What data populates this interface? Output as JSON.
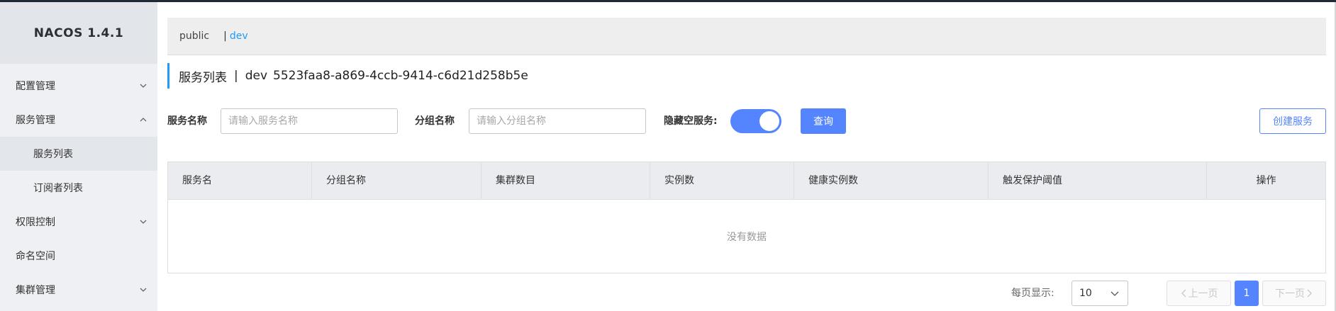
{
  "app": {
    "title": "NACOS 1.4.1"
  },
  "sidebar": {
    "items": [
      {
        "label": "配置管理",
        "icon": "chevron-down-icon"
      },
      {
        "label": "服务管理",
        "icon": "chevron-up-icon"
      },
      {
        "label": "服务列表",
        "selected": true
      },
      {
        "label": "订阅者列表"
      },
      {
        "label": "权限控制",
        "icon": "chevron-down-icon"
      },
      {
        "label": "命名空间"
      },
      {
        "label": "集群管理",
        "icon": "chevron-down-icon"
      }
    ]
  },
  "namespace_bar": {
    "public": "public",
    "separator": "|",
    "dev": "dev"
  },
  "page": {
    "title": "服务列表",
    "separator": "|",
    "namespace": "dev",
    "namespace_id": "5523faa8-a869-4ccb-9414-c6d21d258b5e"
  },
  "filters": {
    "service_name_label": "服务名称",
    "service_name_placeholder": "请输入服务名称",
    "group_name_label": "分组名称",
    "group_name_placeholder": "请输入分组名称",
    "hide_empty_label": "隐藏空服务:",
    "hide_empty_on": true,
    "query_button": "查询",
    "create_button": "创建服务"
  },
  "table": {
    "columns": [
      "服务名",
      "分组名称",
      "集群数目",
      "实例数",
      "健康实例数",
      "触发保护阈值",
      "操作"
    ],
    "rows": [],
    "empty_text": "没有数据"
  },
  "pagination": {
    "page_size_label": "每页显示:",
    "page_size": "10",
    "prev": "上一页",
    "current_page": "1",
    "next": "下一页"
  },
  "colors": {
    "accent": "#5584ff",
    "link": "#209bfa",
    "sidebar_bg": "#eef0f3"
  }
}
